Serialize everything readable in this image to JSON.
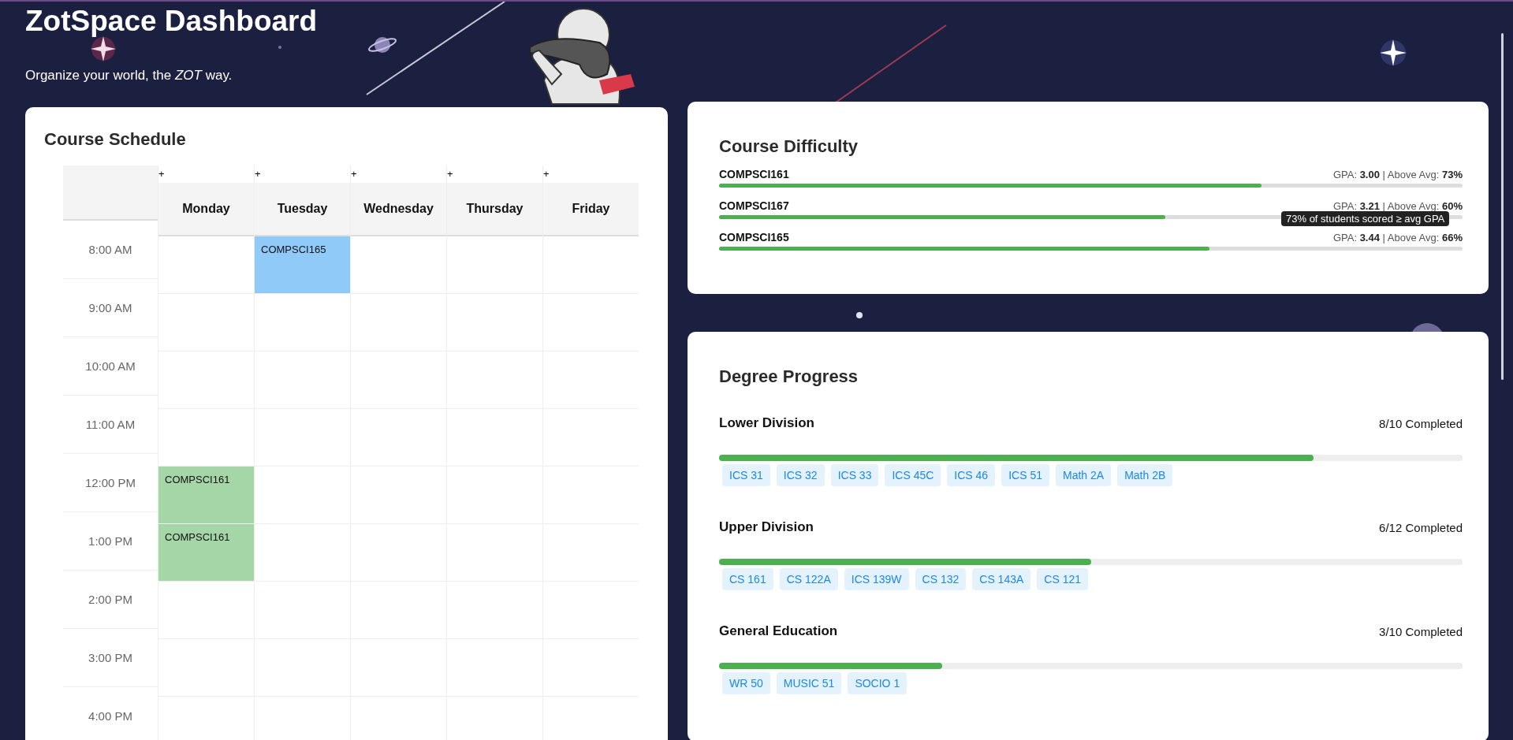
{
  "header": {
    "title": "ZotSpace Dashboard",
    "subtitle": "Organize your world, the *ZOT* way."
  },
  "schedule": {
    "title": "Course Schedule",
    "days": [
      {
        "name": "Monday",
        "add_label": "+"
      },
      {
        "name": "Tuesday",
        "add_label": "+"
      },
      {
        "name": "Wednesday",
        "add_label": "+"
      },
      {
        "name": "Thursday",
        "add_label": "+"
      },
      {
        "name": "Friday",
        "add_label": "+"
      }
    ],
    "rows": [
      {
        "time": "8:00 AM",
        "cells": [
          {
            "kind": "empty"
          },
          {
            "kind": "course",
            "course": "COMPSCI165",
            "color": "#90caf9"
          },
          {
            "kind": "empty"
          },
          {
            "kind": "empty"
          },
          {
            "kind": "empty"
          }
        ]
      },
      {
        "time": "9:00 AM",
        "cells": [
          {
            "kind": "empty"
          },
          {
            "kind": "empty"
          },
          {
            "kind": "empty"
          },
          {
            "kind": "empty"
          },
          {
            "kind": "empty"
          }
        ]
      },
      {
        "time": "10:00 AM",
        "cells": [
          {
            "kind": "empty"
          },
          {
            "kind": "empty"
          },
          {
            "kind": "empty"
          },
          {
            "kind": "empty"
          },
          {
            "kind": "empty"
          }
        ]
      },
      {
        "time": "11:00 AM",
        "cells": [
          {
            "kind": "empty"
          },
          {
            "kind": "empty"
          },
          {
            "kind": "empty"
          },
          {
            "kind": "empty"
          },
          {
            "kind": "empty"
          }
        ]
      },
      {
        "time": "12:00 PM",
        "cells": [
          {
            "kind": "course",
            "course": "COMPSCI161",
            "color": "#a5d6a7"
          },
          {
            "kind": "empty"
          },
          {
            "kind": "empty"
          },
          {
            "kind": "empty"
          },
          {
            "kind": "empty"
          }
        ]
      },
      {
        "time": "1:00 PM",
        "cells": [
          {
            "kind": "course",
            "course": "COMPSCI161",
            "color": "#a5d6a7"
          },
          {
            "kind": "empty"
          },
          {
            "kind": "empty"
          },
          {
            "kind": "empty"
          },
          {
            "kind": "empty"
          }
        ]
      },
      {
        "time": "2:00 PM",
        "cells": [
          {
            "kind": "empty"
          },
          {
            "kind": "empty"
          },
          {
            "kind": "empty"
          },
          {
            "kind": "empty"
          },
          {
            "kind": "empty"
          }
        ]
      },
      {
        "time": "3:00 PM",
        "cells": [
          {
            "kind": "empty"
          },
          {
            "kind": "empty"
          },
          {
            "kind": "empty"
          },
          {
            "kind": "empty"
          },
          {
            "kind": "empty"
          }
        ]
      },
      {
        "time": "4:00 PM",
        "cells": [
          {
            "kind": "empty"
          },
          {
            "kind": "empty"
          },
          {
            "kind": "empty"
          },
          {
            "kind": "empty"
          },
          {
            "kind": "empty"
          }
        ]
      }
    ]
  },
  "difficulty": {
    "title": "Course Difficulty",
    "courses": [
      {
        "name": "COMPSCI161",
        "stats": "GPA: **3.00** | Above Avg: **73%**",
        "level": 0.73
      },
      {
        "name": "COMPSCI167",
        "stats": "GPA: **3.21** | Above Avg: **60%**",
        "level": 0.6
      },
      {
        "name": "COMPSCI165",
        "stats": "GPA: **3.44** | Above Avg: **66%**",
        "level": 0.66
      }
    ],
    "tooltip": "73% of students scored ≥ avg GPA"
  },
  "progress": {
    "title": "Degree Progress",
    "sections": [
      {
        "name": "Lower Division",
        "status": "8/10 Completed",
        "level": 0.8,
        "courses": [
          "ICS 31",
          "ICS 32",
          "ICS 33",
          "ICS 45C",
          "ICS 46",
          "ICS 51",
          "Math 2A",
          "Math 2B"
        ]
      },
      {
        "name": "Upper Division",
        "status": "6/12 Completed",
        "level": 0.5,
        "courses": [
          "CS 161",
          "CS 122A",
          "ICS 139W",
          "CS 132",
          "CS 143A",
          "CS 121"
        ]
      },
      {
        "name": "General Education",
        "status": "3/10 Completed",
        "level": 0.3,
        "courses": [
          "WR 50",
          "MUSIC 51",
          "SOCIO 1"
        ]
      }
    ]
  }
}
